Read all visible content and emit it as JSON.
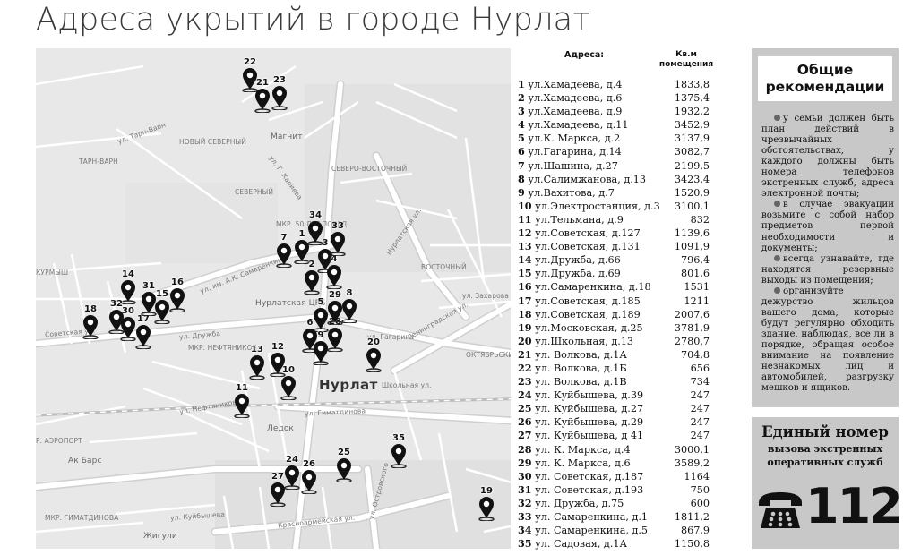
{
  "title": "Адреса укрытий в городе Нурлат",
  "table": {
    "header_address": "Адреса:",
    "header_area": "Кв.м помещения",
    "rows": [
      {
        "num": "1",
        "address": "ул.Хамадеева, д.4",
        "area": "1833,8"
      },
      {
        "num": "2",
        "address": "ул.Хамадеева, д.6",
        "area": "1375,4"
      },
      {
        "num": "3",
        "address": "ул.Хамадеева, д.9",
        "area": "1932,2"
      },
      {
        "num": "4",
        "address": "ул.Хамадеева, д.11",
        "area": "3452,9"
      },
      {
        "num": "5",
        "address": "ул.К. Маркса, д.2",
        "area": "3137,9"
      },
      {
        "num": "6",
        "address": "ул.Гагарина, д.14",
        "area": "3082,7"
      },
      {
        "num": "7",
        "address": "ул.Шашина, д.27",
        "area": "2199,5"
      },
      {
        "num": "8",
        "address": "ул.Салимжанова, д.13",
        "area": "3423,4"
      },
      {
        "num": "9",
        "address": "ул.Вахитова, д.7",
        "area": "1520,9"
      },
      {
        "num": "10",
        "address": "ул.Электростанция, д.3",
        "area": "3100,1"
      },
      {
        "num": "11",
        "address": "ул.Тельмана, д.9",
        "area": "832"
      },
      {
        "num": "12",
        "address": "ул.Советская, д.127",
        "area": "1139,6"
      },
      {
        "num": "13",
        "address": "ул.Советская, д.131",
        "area": "1091,9"
      },
      {
        "num": "14",
        "address": "ул.Дружба, д.66",
        "area": "796,4"
      },
      {
        "num": "15",
        "address": "ул.Дружба, д.69",
        "area": "801,6"
      },
      {
        "num": "16",
        "address": "ул.Самаренкина, д.18",
        "area": "1531"
      },
      {
        "num": "17",
        "address": "ул.Советская, д.185",
        "area": "1211"
      },
      {
        "num": "18",
        "address": "ул.Советская, д.189",
        "area": "2007,6"
      },
      {
        "num": "19",
        "address": "ул.Московская, д.25",
        "area": "3781,9"
      },
      {
        "num": "20",
        "address": "ул.Школьная, д.13",
        "area": "2780,7"
      },
      {
        "num": "21",
        "address": "ул. Волкова, д.1А",
        "area": "704,8"
      },
      {
        "num": "22",
        "address": "ул. Волкова, д.1Б",
        "area": "656"
      },
      {
        "num": "23",
        "address": "ул. Волкова, д.1В",
        "area": "734"
      },
      {
        "num": "24",
        "address": "ул. Куйбышева, д.39",
        "area": "247"
      },
      {
        "num": "25",
        "address": "ул. Куйбышева, д.27",
        "area": "247"
      },
      {
        "num": "26",
        "address": "ул. Куйбышева, д.29",
        "area": "247"
      },
      {
        "num": "27",
        "address": "ул. Куйбышева, д 41",
        "area": "247"
      },
      {
        "num": "28",
        "address": "ул. К. Маркса, д.4",
        "area": "3000,1"
      },
      {
        "num": "29",
        "address": "ул. К. Маркса, д.6",
        "area": "3589,2"
      },
      {
        "num": "30",
        "address": "ул. Советская, д.187",
        "area": "1164"
      },
      {
        "num": "31",
        "address": "ул. Советская, д.193",
        "area": "750"
      },
      {
        "num": "32",
        "address": "ул. Дружба, д.75",
        "area": "600"
      },
      {
        "num": "33",
        "address": "ул. Самаренкина, д.1",
        "area": "1811,2"
      },
      {
        "num": "34",
        "address": "ул. Самаренкина, д.5",
        "area": "867,9"
      },
      {
        "num": "35",
        "address": "ул. Садовая, д.1А",
        "area": "1150,8"
      }
    ]
  },
  "map": {
    "labels": {
      "city": "Нурлат",
      "magnit": "Магнит",
      "nurlat_center": "Нурлатская ЦРБ",
      "ledok": "Ледок",
      "ak_bars": "Ак Барс",
      "zhiguli": "Жигули",
      "severny_new": "НОВЫЙ СЕВЕРНЫЙ",
      "tarn_varn": "ТАРН-ВАРН",
      "severny": "СЕВЕРНЫЙ",
      "severo_vostochny": "СЕВЕРО-ВОСТОЧНЫЙ",
      "vostochny": "ВОСТОЧНЫЙ",
      "kurmysh": "КУРМЫШ",
      "neftyanikov": "МКР. НЕФТЯНИКОВ",
      "aeroport": "Р. АЭРОПОРТ",
      "gimatdinova": "МКР. ГИМАТДИНОВА",
      "kurmysh_street": "ул. Куйбышева",
      "sovetskaya": "Советская ул.",
      "druzhba": "ул. Дружба",
      "samarenkina": "ул. им. А.К. Самаренкина",
      "leningradskaya": "Ленинградская ул.",
      "nurlatskaya": "Нурлатская ул.",
      "gimatdinova_street": "ул. Гиматдинова",
      "zakharova": "ул. Захарова",
      "gagarina": "ул. Гагарина",
      "shkolnaya": "Школьная ул.",
      "neftyanikov_street": "ул. Нефтяников",
      "karieva": "ул. Г. Кариева",
      "tarn_varn_street": "ул. Тарн-Варн",
      "ostrovskogo": "ул. Островского",
      "krasnoarmeyskaya": "Красноармейская ул.",
      "oktyabrskaya": "ОКТЯБРЬСКИ",
      "mkr_50": "МКР. 50 ЛЕТ ПОБЕД"
    }
  },
  "recommendations": {
    "title": "Общие рекомендации",
    "items": [
      "у семьи должен быть план действий в чрезвычайных обстоятельствах, у каждого должны быть номера телефонов экстренных служб, адреса электронной почты;",
      "в случае эвакуации возьмите с собой набор предметов первой необходимости и документы;",
      "всегда узнавайте, где находятся резервные выходы из помещения;",
      "организуйте дежурство жильцов вашего дома, которые будут регулярно обходить здание, наблюдая, все ли в порядке, обращая особое внимание на появление незнакомых лиц и автомобилей, разгрузку мешков и ящиков."
    ]
  },
  "emergency": {
    "title": "Единый номер",
    "subtitle": "вызова экстренных оперативных служб",
    "number": "112",
    "icon": "telephone-icon"
  }
}
